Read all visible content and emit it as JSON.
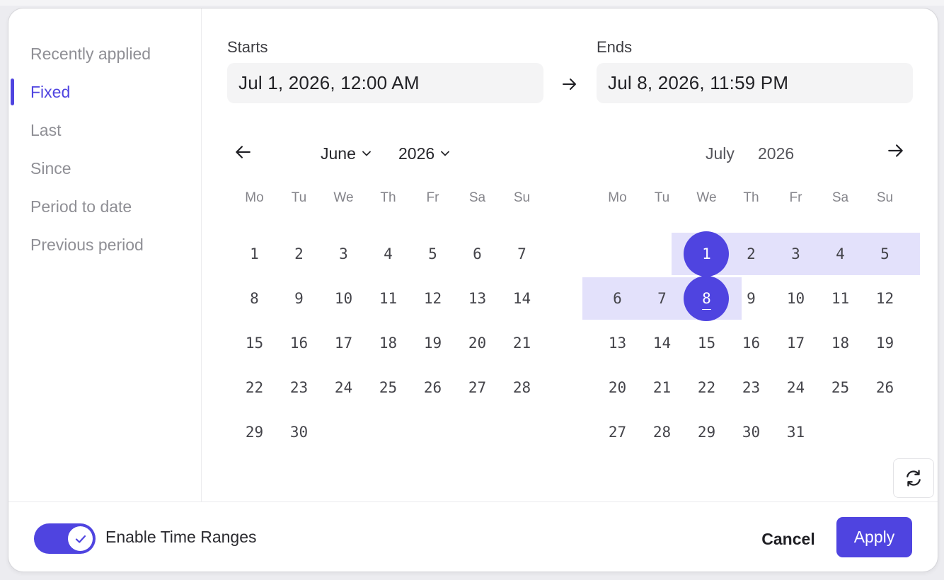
{
  "sidebar": {
    "items": [
      {
        "label": "Recently applied",
        "active": false
      },
      {
        "label": "Fixed",
        "active": true
      },
      {
        "label": "Last",
        "active": false
      },
      {
        "label": "Since",
        "active": false
      },
      {
        "label": "Period to date",
        "active": false
      },
      {
        "label": "Previous period",
        "active": false
      }
    ]
  },
  "range": {
    "starts_label": "Starts",
    "starts_value": "Jul 1, 2026, 12:00 AM",
    "ends_label": "Ends",
    "ends_value": "Jul 8, 2026, 11:59 PM"
  },
  "weekdays": [
    "Mo",
    "Tu",
    "We",
    "Th",
    "Fr",
    "Sa",
    "Su"
  ],
  "calendars": [
    {
      "month": "June",
      "year": "2026",
      "has_dropdowns": true,
      "first_weekday": 0,
      "days": 30,
      "selected_start": null,
      "selected_end": null,
      "range_from": null,
      "range_to": null
    },
    {
      "month": "July",
      "year": "2026",
      "has_dropdowns": false,
      "first_weekday": 2,
      "days": 31,
      "selected_start": 1,
      "selected_end": 8,
      "range_from": 1,
      "range_to": 8
    }
  ],
  "footer": {
    "toggle_label": "Enable Time Ranges",
    "toggle_on": true,
    "cancel_label": "Cancel",
    "apply_label": "Apply"
  },
  "colors": {
    "accent": "#4f44e0",
    "range_band": "#e3e1fb"
  },
  "icons": {
    "prev": "arrow-left-icon",
    "next": "arrow-right-icon",
    "range_separator": "arrow-right-icon",
    "refresh": "refresh-icon",
    "toggle_check": "check-icon"
  }
}
